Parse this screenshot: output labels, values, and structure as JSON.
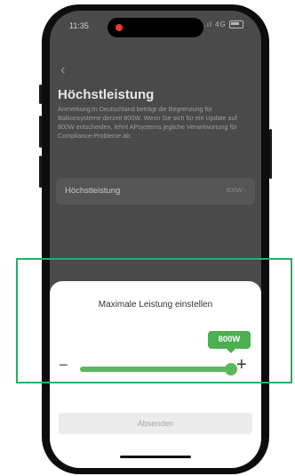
{
  "status_bar": {
    "time": "11:35",
    "network": "4G",
    "signal_icon": "signal-bars-icon",
    "battery_icon": "battery-icon"
  },
  "page": {
    "back_icon": "chevron-left-icon",
    "title": "Höchstleistung",
    "note": "Anmerkung:In Deutschland beträgt die Begrenzung für Balkonsysteme derzeit 800W. Wenn Sie sich für ein Update auf 800W entscheiden, lehnt APsystems jegliche Verantwortung für Compliance-Probleme ab.",
    "setting_row": {
      "label": "Höchstleistung",
      "value": "800W",
      "chevron": "›"
    }
  },
  "sheet": {
    "title": "Maximale Leistung einstellen",
    "badge_value": "800W",
    "minus_symbol": "−",
    "plus_symbol": "+",
    "slider_level_percent": 100,
    "submit_label": "Absenden"
  },
  "colors": {
    "accent_green": "#5cb85c",
    "highlight_box": "#1fb26b",
    "recording_dot": "#e53935"
  }
}
